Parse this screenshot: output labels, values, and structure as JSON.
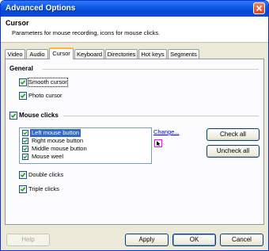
{
  "window": {
    "title": "Advanced Options"
  },
  "header": {
    "title": "Cursor",
    "subtitle": "Parameters for mouse recording, icons for mouse clicks."
  },
  "tabs": [
    {
      "label": "Video",
      "active": false
    },
    {
      "label": "Audio",
      "active": false
    },
    {
      "label": "Cursor",
      "active": true
    },
    {
      "label": "Keyboard",
      "active": false
    },
    {
      "label": "Directories",
      "active": false
    },
    {
      "label": "Hot keys",
      "active": false
    },
    {
      "label": "Segments",
      "active": false
    }
  ],
  "general": {
    "label": "General",
    "smooth_cursor": {
      "label": "Smooth cursor",
      "checked": true
    },
    "photo_cursor": {
      "label": "Photo cursor",
      "checked": true
    }
  },
  "mouse_clicks": {
    "label": "Mouse clicks",
    "checked": true,
    "items": [
      {
        "label": "Left mouse button",
        "checked": true,
        "selected": true
      },
      {
        "label": "Right mouse button",
        "checked": true,
        "selected": false
      },
      {
        "label": "Middle mouse button",
        "checked": true,
        "selected": false
      },
      {
        "label": "Mouse weel",
        "checked": true,
        "selected": false
      }
    ],
    "change_link": "Change...",
    "check_all": "Check all",
    "uncheck_all": "Uncheck all",
    "double_clicks": {
      "label": "Double clicks",
      "checked": true
    },
    "triple_clicks": {
      "label": "Triple clicks",
      "checked": true
    }
  },
  "footer": {
    "help": "Help",
    "apply": "Apply",
    "ok": "OK",
    "cancel": "Cancel"
  },
  "colors": {
    "titlebar": "#0846d4",
    "check": "#21a121",
    "selection": "#316ac5",
    "link": "#0000ee"
  }
}
